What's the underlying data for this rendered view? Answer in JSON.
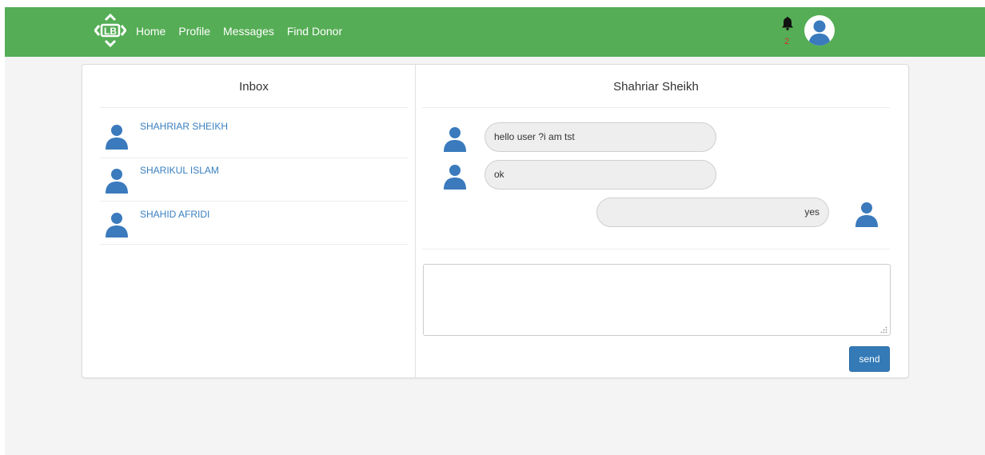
{
  "nav": {
    "logo_icon": "lb-logo-icon",
    "links": [
      "Home",
      "Profile",
      "Messages",
      "Find Donor"
    ],
    "notification_count": "2",
    "colors": {
      "navbar": "#55ad55",
      "link": "#ffffff",
      "badge": "#d32f2f"
    }
  },
  "inbox": {
    "title": "Inbox",
    "items": [
      {
        "name": "SHAHRIAR SHEIKH",
        "avatar": "user-avatar-icon"
      },
      {
        "name": "SHARIKUL ISLAM",
        "avatar": "user-avatar-icon"
      },
      {
        "name": "SHAHID AFRIDI",
        "avatar": "user-avatar-icon"
      }
    ]
  },
  "chat": {
    "title": "Shahriar Sheikh",
    "messages": [
      {
        "text": "hello user ?i am tst",
        "side": "left"
      },
      {
        "text": "ok",
        "side": "left"
      },
      {
        "text": "yes",
        "side": "right"
      }
    ],
    "input_value": "",
    "send_label": "send",
    "colors": {
      "avatar": "#3a7abd",
      "send_button": "#337ab7"
    }
  }
}
